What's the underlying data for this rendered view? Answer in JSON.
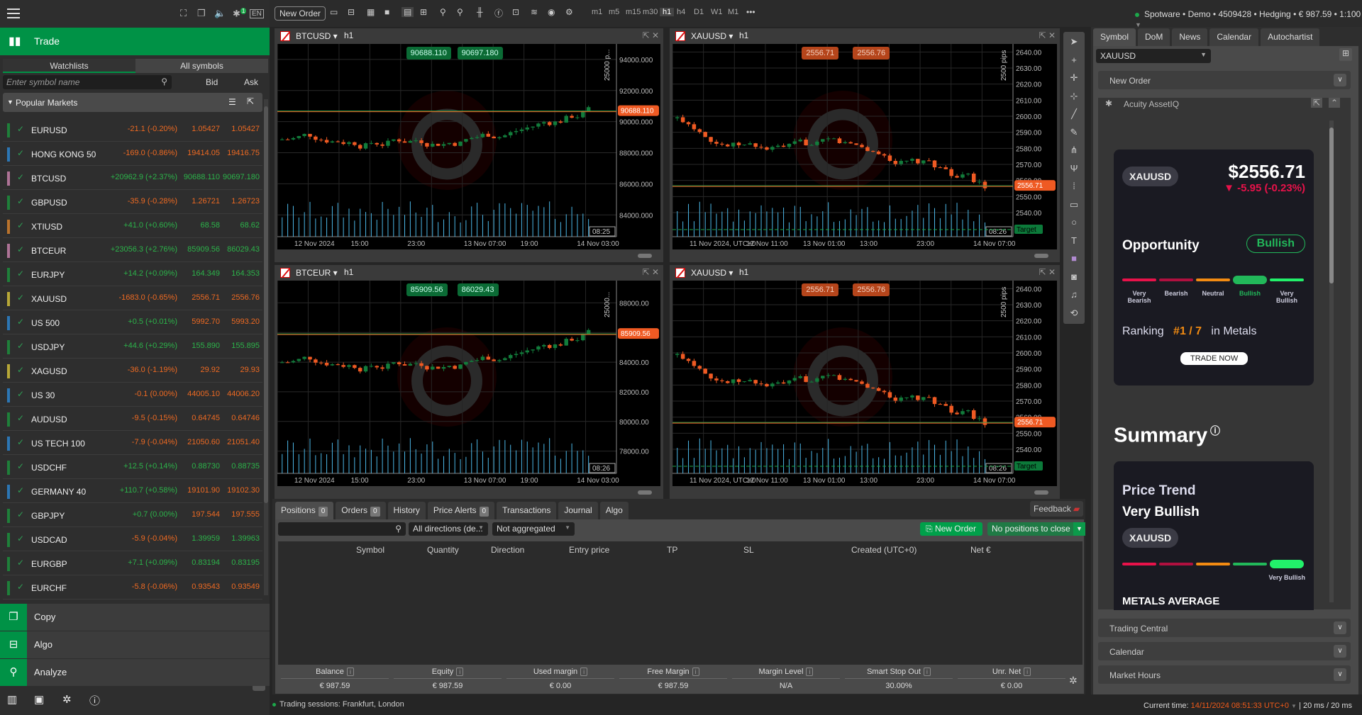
{
  "topbar": {
    "icons": [
      "fullscreen-icon",
      "window-icon",
      "sound-icon",
      "plugin-icon",
      "language-icon"
    ],
    "plugin_badge": "1",
    "language": "EN",
    "new_order_label": "New Order",
    "timeframes": [
      "m1",
      "m5",
      "m15",
      "m30",
      "h1",
      "h4",
      "D1",
      "W1",
      "M1"
    ],
    "active_timeframe": "h1",
    "more": "•••",
    "account": "Spotware • Demo • 4509428 • Hedging • € 987.59 • 1:100"
  },
  "sidebar": {
    "trade_label": "Trade",
    "tabs": [
      "Watchlists",
      "All symbols"
    ],
    "search_placeholder": "Enter symbol name",
    "bid_label": "Bid",
    "ask_label": "Ask",
    "group_label": "Popular Markets",
    "watchlist": [
      {
        "symbol": "EURUSD",
        "change": "-21.1 (-0.20%)",
        "bid": "1.05427",
        "ask": "1.05427",
        "dir": "dn",
        "bid_dir": "dn",
        "color": "#1a9c3e"
      },
      {
        "symbol": "HONG KONG 50",
        "change": "-169.0 (-0.86%)",
        "bid": "19414.05",
        "ask": "19416.75",
        "dir": "dn",
        "bid_dir": "dn",
        "color": "#2b8ee0"
      },
      {
        "symbol": "BTCUSD",
        "change": "+20962.9 (+2.37%)",
        "bid": "90688.110",
        "ask": "90697.180",
        "dir": "up",
        "bid_dir": "up",
        "color": "#d98ab8"
      },
      {
        "symbol": "GBPUSD",
        "change": "-35.9 (-0.28%)",
        "bid": "1.26721",
        "ask": "1.26723",
        "dir": "dn",
        "bid_dir": "dn",
        "color": "#1a9c3e"
      },
      {
        "symbol": "XTIUSD",
        "change": "+41.0 (+0.60%)",
        "bid": "68.58",
        "ask": "68.62",
        "dir": "up",
        "bid_dir": "up",
        "color": "#e98a2c"
      },
      {
        "symbol": "BTCEUR",
        "change": "+23056.3 (+2.76%)",
        "bid": "85909.56",
        "ask": "86029.43",
        "dir": "up",
        "bid_dir": "up",
        "color": "#d98ab8"
      },
      {
        "symbol": "EURJPY",
        "change": "+14.2 (+0.09%)",
        "bid": "164.349",
        "ask": "164.353",
        "dir": "up",
        "bid_dir": "up",
        "color": "#1a9c3e"
      },
      {
        "symbol": "XAUUSD",
        "change": "-1683.0 (-0.65%)",
        "bid": "2556.71",
        "ask": "2556.76",
        "dir": "dn",
        "bid_dir": "dn",
        "color": "#e6d13a"
      },
      {
        "symbol": "US 500",
        "change": "+0.5 (+0.01%)",
        "bid": "5992.70",
        "ask": "5993.20",
        "dir": "up",
        "bid_dir": "dn",
        "color": "#2b8ee0"
      },
      {
        "symbol": "USDJPY",
        "change": "+44.6 (+0.29%)",
        "bid": "155.890",
        "ask": "155.895",
        "dir": "up",
        "bid_dir": "up",
        "color": "#1a9c3e"
      },
      {
        "symbol": "XAGUSD",
        "change": "-36.0 (-1.19%)",
        "bid": "29.92",
        "ask": "29.93",
        "dir": "dn",
        "bid_dir": "dn",
        "color": "#e6d13a"
      },
      {
        "symbol": "US 30",
        "change": "-0.1 (0.00%)",
        "bid": "44005.10",
        "ask": "44006.20",
        "dir": "dn",
        "bid_dir": "dn",
        "color": "#2b8ee0"
      },
      {
        "symbol": "AUDUSD",
        "change": "-9.5 (-0.15%)",
        "bid": "0.64745",
        "ask": "0.64746",
        "dir": "dn",
        "bid_dir": "dn",
        "color": "#1a9c3e"
      },
      {
        "symbol": "US TECH 100",
        "change": "-7.9 (-0.04%)",
        "bid": "21050.60",
        "ask": "21051.40",
        "dir": "dn",
        "bid_dir": "dn",
        "color": "#2b8ee0"
      },
      {
        "symbol": "USDCHF",
        "change": "+12.5 (+0.14%)",
        "bid": "0.88730",
        "ask": "0.88735",
        "dir": "up",
        "bid_dir": "up",
        "color": "#1a9c3e"
      },
      {
        "symbol": "GERMANY 40",
        "change": "+110.7 (+0.58%)",
        "bid": "19101.90",
        "ask": "19102.30",
        "dir": "up",
        "bid_dir": "dn",
        "color": "#2b8ee0"
      },
      {
        "symbol": "GBPJPY",
        "change": "+0.7 (0.00%)",
        "bid": "197.544",
        "ask": "197.555",
        "dir": "up",
        "bid_dir": "dn",
        "color": "#1a9c3e"
      },
      {
        "symbol": "USDCAD",
        "change": "-5.9 (-0.04%)",
        "bid": "1.39959",
        "ask": "1.39963",
        "dir": "dn",
        "bid_dir": "up",
        "color": "#1a9c3e"
      },
      {
        "symbol": "EURGBP",
        "change": "+7.1 (+0.09%)",
        "bid": "0.83194",
        "ask": "0.83195",
        "dir": "up",
        "bid_dir": "up",
        "color": "#1a9c3e"
      },
      {
        "symbol": "EURCHF",
        "change": "-5.8 (-0.06%)",
        "bid": "0.93543",
        "ask": "0.93549",
        "dir": "dn",
        "bid_dir": "dn",
        "color": "#1a9c3e"
      }
    ],
    "nav": [
      {
        "label": "Copy",
        "icon": "copy-icon",
        "glyph": "❐"
      },
      {
        "label": "Algo",
        "icon": "robot-icon",
        "glyph": "⊟"
      },
      {
        "label": "Analyze",
        "icon": "analyze-icon",
        "glyph": "⚲"
      }
    ]
  },
  "charts": [
    {
      "symbol": "BTCUSD",
      "timeframe": "h1",
      "bid": "90688.110",
      "ask": "90697.180",
      "box": "green",
      "price_label": "90688.110",
      "range_label": "25000 p...",
      "yticks": [
        "94000.000",
        "92000.000",
        "90000.000",
        "88000.000",
        "86000.000",
        "84000.000"
      ],
      "ymin": 82600,
      "ymax": 95000,
      "price": 90688,
      "xticks": [
        "12 Nov 2024",
        "15:00",
        "23:00",
        "13 Nov 07:00",
        "19:00",
        "14 Nov 03:00"
      ],
      "countdown": "08:25",
      "target": false
    },
    {
      "symbol": "XAUUSD",
      "timeframe": "h1",
      "bid": "2556.71",
      "ask": "2556.76",
      "box": "red",
      "price_label": "2556.71",
      "range_label": "2500 pips",
      "yticks": [
        "2640.00",
        "2630.00",
        "2620.00",
        "2610.00",
        "2600.00",
        "2590.00",
        "2580.00",
        "2570.00",
        "2560.00",
        "2550.00",
        "2540.00"
      ],
      "ymin": 2525,
      "ymax": 2645,
      "price": 2556.71,
      "xticks": [
        "11 Nov 2024, UTC+0",
        "12 Nov 11:00",
        "13 Nov 01:00",
        "13:00",
        "23:00",
        "14 Nov 07:00"
      ],
      "countdown": "08:26",
      "target": true,
      "target_label": "Target"
    },
    {
      "symbol": "BTCEUR",
      "timeframe": "h1",
      "bid": "85909.56",
      "ask": "86029.43",
      "box": "green",
      "price_label": "85909.56",
      "range_label": "25000...",
      "yticks": [
        "88000.00",
        "86000.00",
        "84000.00",
        "82000.00",
        "80000.00",
        "78000.00"
      ],
      "ymin": 76500,
      "ymax": 89500,
      "price": 85909,
      "xticks": [
        "12 Nov 2024",
        "15:00",
        "23:00",
        "13 Nov 07:00",
        "19:00",
        "14 Nov 03:00"
      ],
      "countdown": "08:26",
      "target": false
    },
    {
      "symbol": "XAUUSD",
      "timeframe": "h1",
      "bid": "2556.71",
      "ask": "2556.76",
      "box": "red",
      "price_label": "2556.71",
      "range_label": "2500 pips",
      "yticks": [
        "2640.00",
        "2630.00",
        "2620.00",
        "2610.00",
        "2600.00",
        "2590.00",
        "2580.00",
        "2570.00",
        "2560.00",
        "2550.00",
        "2540.00"
      ],
      "ymin": 2525,
      "ymax": 2645,
      "price": 2556.71,
      "xticks": [
        "11 Nov 2024, UTC+0",
        "12 Nov 11:00",
        "13 Nov 01:00",
        "13:00",
        "23:00",
        "14 Nov 07:00"
      ],
      "countdown": "08:26",
      "target": true,
      "target_label": "Target"
    }
  ],
  "drawbar": [
    "pointer-icon",
    "crosshair-icon",
    "crosshair-plus-icon",
    "crosshair-box-icon",
    "trendline-icon",
    "brush-icon",
    "pitchfork-icon",
    "fork-icon",
    "fibonacci-icon",
    "rectangle-icon",
    "ellipse-icon",
    "text-icon",
    "color-swatch-icon",
    "camera-icon",
    "bell-icon",
    "replay-icon"
  ],
  "right": {
    "tabs": [
      "Symbol",
      "DoM",
      "News",
      "Calendar",
      "Autochartist"
    ],
    "active_tab": "Symbol",
    "symbol": "XAUUSD",
    "new_order": "New Order",
    "widget_title": "Acuity AssetIQ",
    "card": {
      "symbol": "XAUUSD",
      "price": "$2556.71",
      "change": "-5.95 (-0.23%)",
      "opportunity": "Opportunity",
      "sentiment": "Bullish",
      "scale": [
        "Very Bearish",
        "Bearish",
        "Neutral",
        "Bullish",
        "Very Bullish"
      ],
      "scale_colors": [
        "#e8124a",
        "#b0103f",
        "#f38b12",
        "#22b85a",
        "#22f06a"
      ],
      "active_index": 3,
      "ranking_label": "Ranking",
      "rank": "#1 / 7",
      "rank_suffix": "in Metals",
      "trade_now": "TRADE NOW"
    },
    "summary_title": "Summary",
    "trend": {
      "title": "Price Trend",
      "value": "Very Bullish",
      "symbol": "XAUUSD",
      "active_index": 4,
      "active_label": "Very Bullish"
    },
    "metals_avg": "METALS AVERAGE",
    "accordions": [
      "Trading Central",
      "Calendar",
      "Market Hours"
    ]
  },
  "bottom": {
    "tabs": [
      {
        "label": "Positions",
        "count": "0"
      },
      {
        "label": "Orders",
        "count": "0"
      },
      {
        "label": "History"
      },
      {
        "label": "Price Alerts",
        "count": "0"
      },
      {
        "label": "Transactions"
      },
      {
        "label": "Journal"
      },
      {
        "label": "Algo"
      }
    ],
    "feedback": "Feedback",
    "direction_filter": "All directions (de...",
    "aggregation": "Not aggregated",
    "new_order": "New Order",
    "close_all": "No positions to close",
    "columns": [
      "Symbol",
      "Quantity",
      "Direction",
      "Entry price",
      "TP",
      "SL",
      "Created (UTC+0)",
      "Net €"
    ],
    "summary": [
      {
        "label": "Balance",
        "value": "€ 987.59"
      },
      {
        "label": "Equity",
        "value": "€ 987.59"
      },
      {
        "label": "Used margin",
        "value": "€ 0.00"
      },
      {
        "label": "Free Margin",
        "value": "€ 987.59"
      },
      {
        "label": "Margin Level",
        "value": "N/A"
      },
      {
        "label": "Smart Stop Out",
        "value": "30.00%"
      },
      {
        "label": "Unr. Net",
        "value": "€ 0.00"
      }
    ]
  },
  "status": {
    "sessions": "Trading sessions: Frankfurt, London",
    "current_time_label": "Current time:",
    "current_time": "14/11/2024 08:51:33",
    "timezone": "UTC+0",
    "latency": "| 20 ms / 20 ms"
  }
}
